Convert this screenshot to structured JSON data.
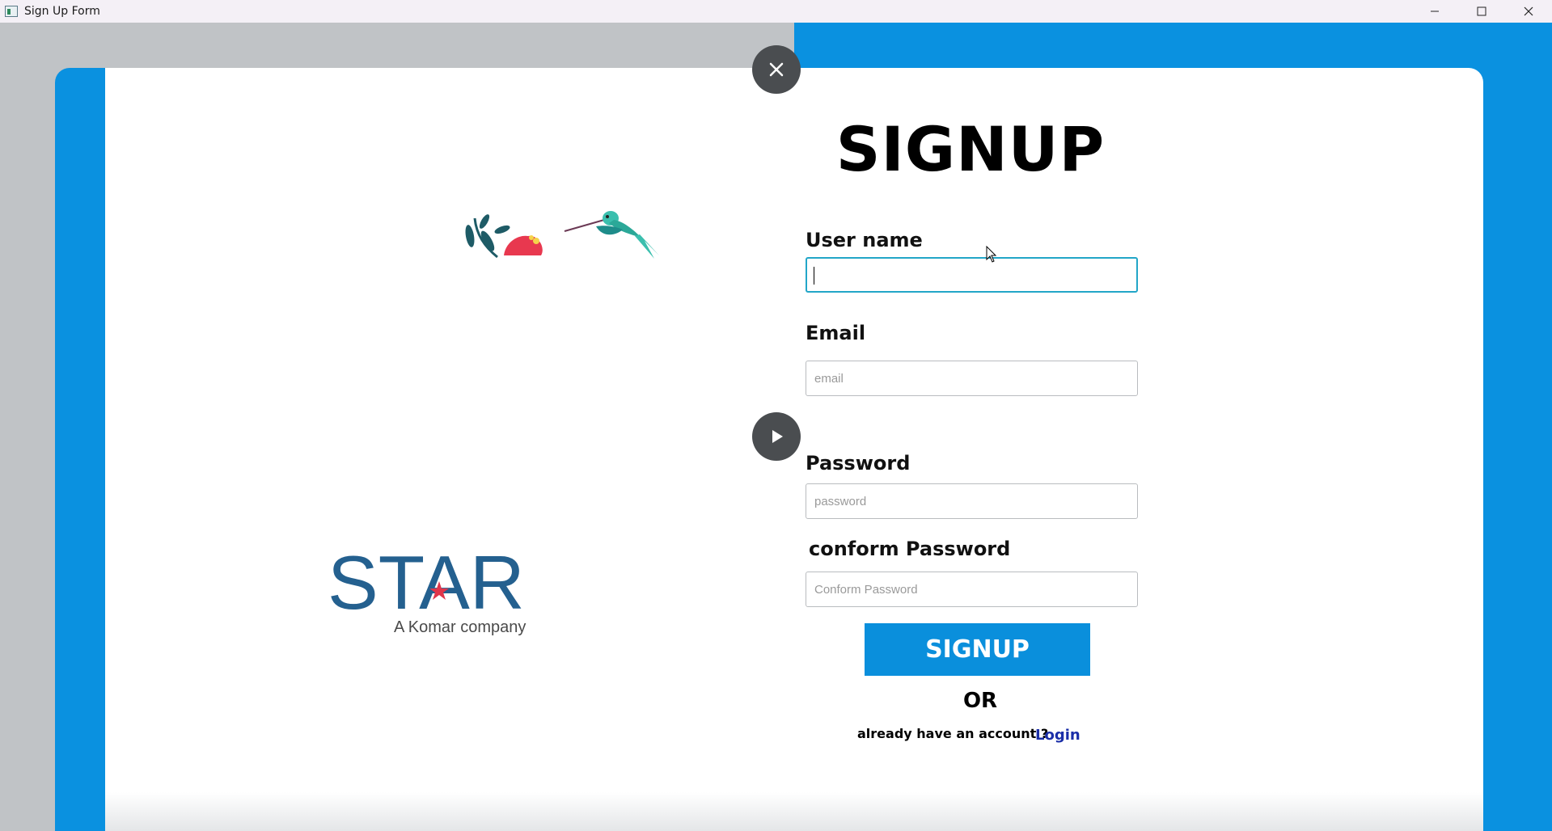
{
  "window": {
    "title": "Sign Up Form",
    "controls": [
      "minimize-icon",
      "maximize-icon",
      "close-icon"
    ]
  },
  "colors": {
    "accent": "#0a91e0",
    "button": "#0a8fdc",
    "link": "#1a2ea8",
    "focus_border": "#22a6c8"
  },
  "left_panel": {
    "logo_text": "STAR",
    "logo_subtitle": "A Komar company"
  },
  "form": {
    "heading": "SIGNUP",
    "username": {
      "label": "User name",
      "value": "",
      "placeholder": ""
    },
    "email": {
      "label": "Email",
      "value": "",
      "placeholder": "email"
    },
    "password": {
      "label": "Password",
      "value": "",
      "placeholder": "password"
    },
    "confirm_password": {
      "label": "conform Password",
      "value": "",
      "placeholder": "Conform Password"
    },
    "submit_label": "SIGNUP",
    "or_text": "OR",
    "have_account_text": "already have an account  ?",
    "login_label": "Login"
  }
}
